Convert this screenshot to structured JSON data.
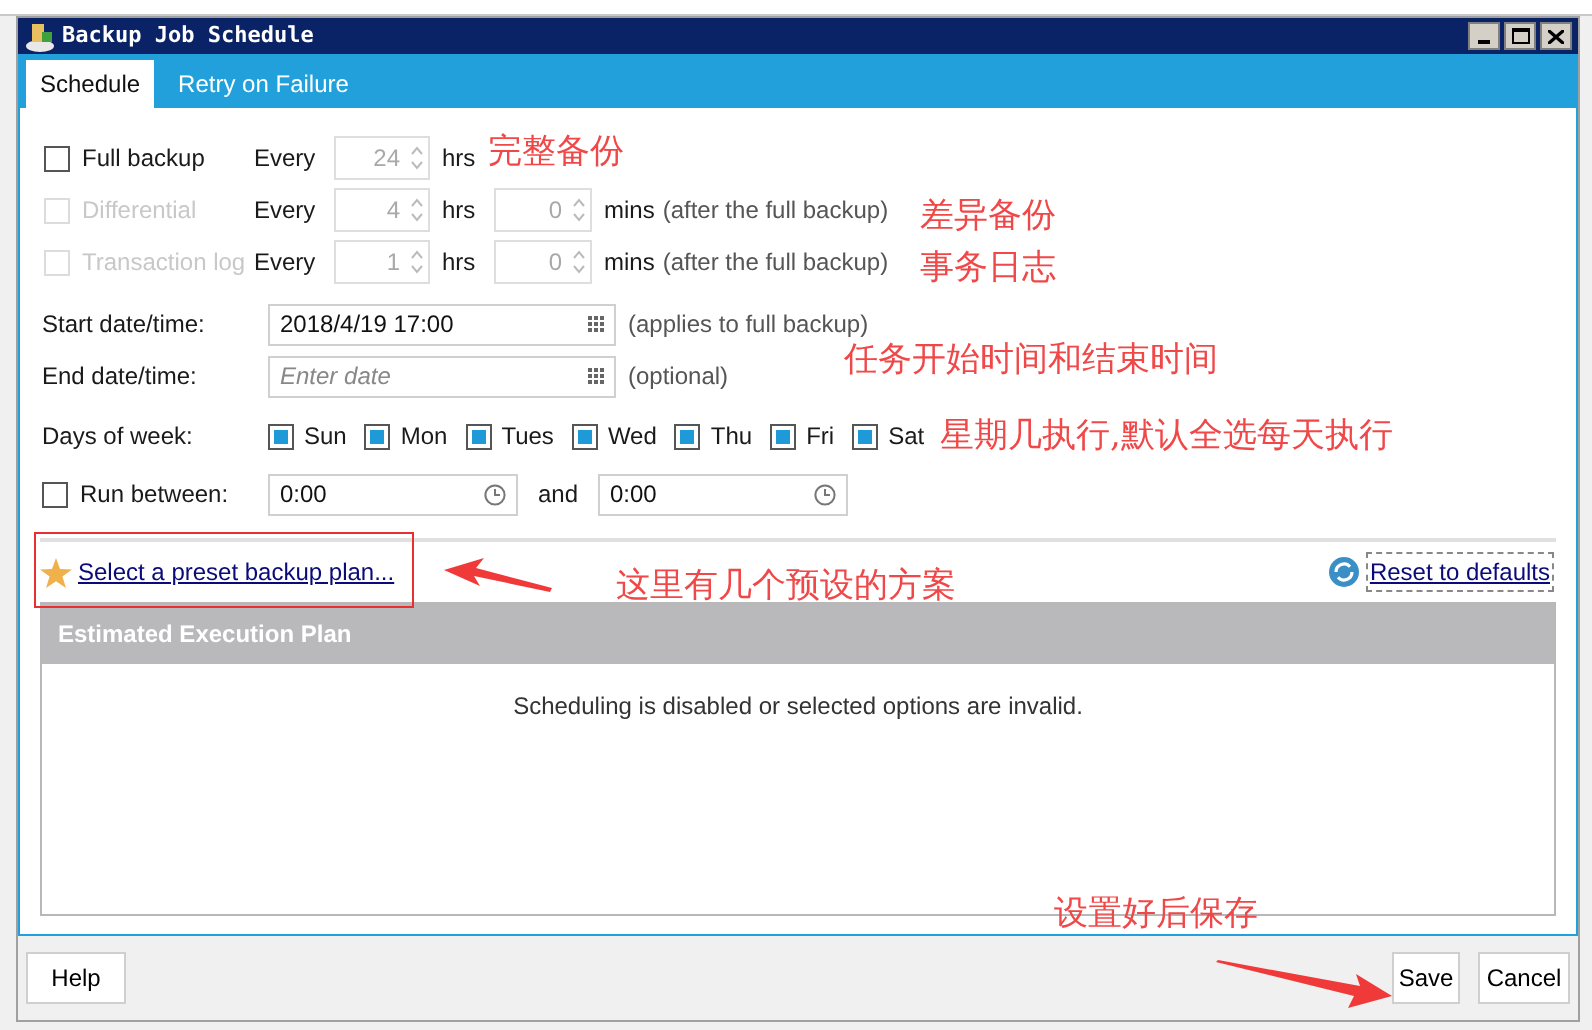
{
  "window": {
    "title": "Backup Job Schedule"
  },
  "tabs": [
    {
      "label": "Schedule",
      "selected": true
    },
    {
      "label": "Retry on Failure",
      "selected": false
    }
  ],
  "backup_types": [
    {
      "label": "Full backup",
      "checked": false,
      "disabled": false,
      "every": "Every",
      "hours": "24",
      "hours_unit": "hrs"
    },
    {
      "label": "Differential",
      "checked": false,
      "disabled": true,
      "every": "Every",
      "hours": "4",
      "hours_unit": "hrs",
      "minutes": "0",
      "minutes_unit": "mins",
      "note": "(after the full backup)"
    },
    {
      "label": "Transaction log",
      "checked": false,
      "disabled": true,
      "every": "Every",
      "hours": "1",
      "hours_unit": "hrs",
      "minutes": "0",
      "minutes_unit": "mins",
      "note": "(after the full backup)"
    }
  ],
  "start_date": {
    "label": "Start date/time:",
    "value": "2018/4/19 17:00",
    "note": "(applies to full backup)"
  },
  "end_date": {
    "label": "End date/time:",
    "placeholder": "Enter date",
    "note": "(optional)"
  },
  "days_of_week": {
    "label": "Days of week:",
    "items": [
      {
        "label": "Sun",
        "checked": true
      },
      {
        "label": "Mon",
        "checked": true
      },
      {
        "label": "Tues",
        "checked": true
      },
      {
        "label": "Wed",
        "checked": true
      },
      {
        "label": "Thu",
        "checked": true
      },
      {
        "label": "Fri",
        "checked": true
      },
      {
        "label": "Sat",
        "checked": true
      }
    ]
  },
  "run_between": {
    "label": "Run between:",
    "checked": false,
    "from": "0:00",
    "and": "and",
    "to": "0:00"
  },
  "preset_link": "Select a preset backup plan...",
  "reset_link": "Reset to defaults",
  "plan": {
    "title": "Estimated Execution Plan",
    "message": "Scheduling is disabled or selected options are invalid."
  },
  "buttons": {
    "help": "Help",
    "save": "Save",
    "cancel": "Cancel"
  },
  "annotations": [
    {
      "text": "完整备份"
    },
    {
      "text": "差异备份"
    },
    {
      "text": "事务日志"
    },
    {
      "text": "任务开始时间和结束时间"
    },
    {
      "text": "星期几执行,默认全选每天执行"
    },
    {
      "text": "这里有几个预设的方案"
    },
    {
      "text": "设置好后保存"
    }
  ]
}
